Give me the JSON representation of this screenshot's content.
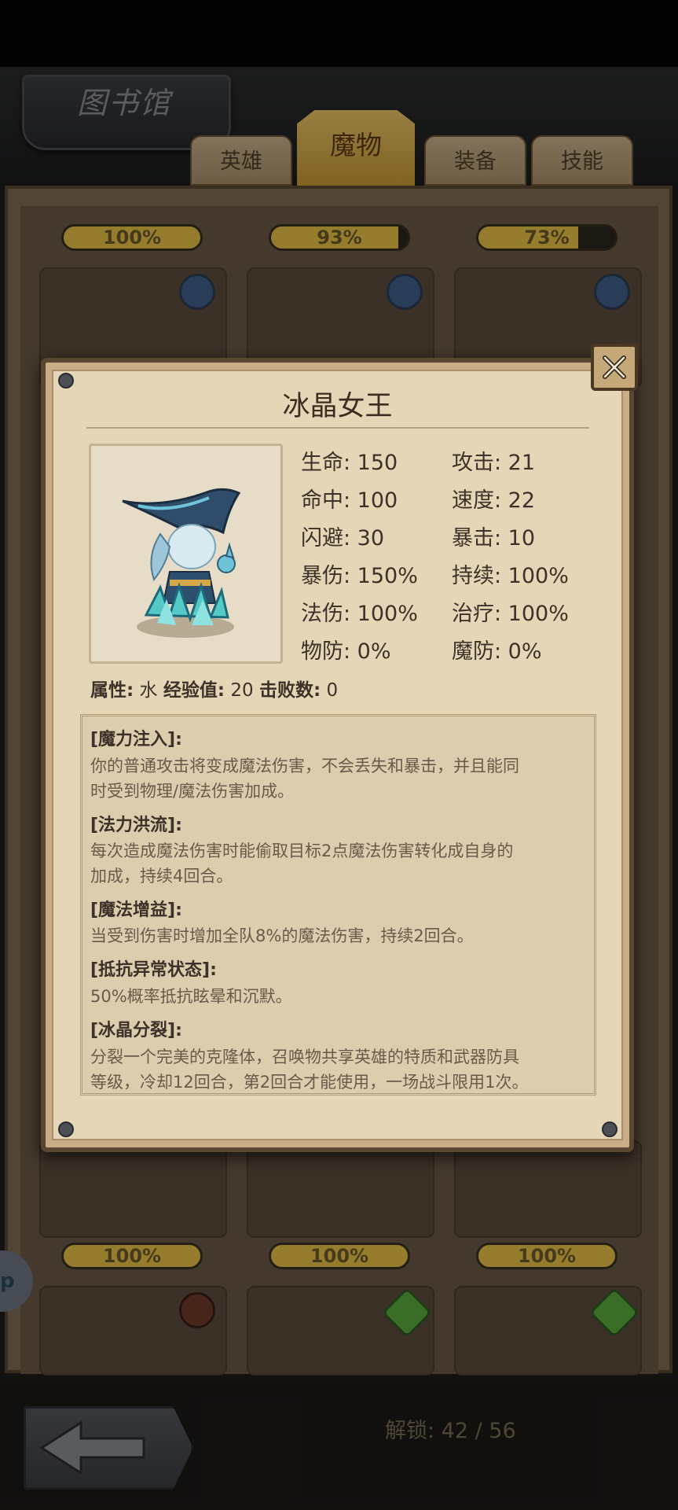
{
  "header": {
    "title": "图书馆",
    "tabs": [
      {
        "label": "英雄",
        "active": false
      },
      {
        "label": "魔物",
        "active": true
      },
      {
        "label": "装备",
        "active": false
      },
      {
        "label": "技能",
        "active": false
      }
    ]
  },
  "library": {
    "top_row_progress": [
      "100%",
      "93%",
      "73%"
    ],
    "top_row_fill": [
      1.0,
      0.93,
      0.73
    ],
    "bottom_row_progress": [
      "100%",
      "100%",
      "100%"
    ]
  },
  "monster": {
    "name": "冰晶女王",
    "stats": {
      "hp": "生命: 150",
      "attack": "攻击: 21",
      "hit": "命中: 100",
      "speed": "速度: 22",
      "dodge": "闪避: 30",
      "crit": "暴击: 10",
      "crit_damage": "暴伤: 150%",
      "duration": "持续: 100%",
      "magic_damage": "法伤: 100%",
      "healing": "治疗: 100%",
      "phys_def": "物防: 0%",
      "magic_def": "魔防: 0%"
    },
    "info": {
      "attribute_label": "属性:",
      "attribute_value": "水",
      "exp_label": "经验值:",
      "exp_value": "20",
      "defeats_label": "击败数:",
      "defeats_value": "0"
    },
    "skills": [
      {
        "name": "[魔力注入]:",
        "desc_lines": [
          "你的普通攻击将变成魔法伤害，不会丢失和暴击，并且能同",
          "时受到物理/魔法伤害加成。"
        ]
      },
      {
        "name": "[法力洪流]:",
        "desc_lines": [
          "每次造成魔法伤害时能偷取目标2点魔法伤害转化成自身的",
          "加成，持续4回合。"
        ]
      },
      {
        "name": "[魔法增益]:",
        "desc_lines": [
          "当受到伤害时增加全队8%的魔法伤害，持续2回合。"
        ]
      },
      {
        "name": "[抵抗异常状态]:",
        "desc_lines": [
          "50%概率抵抗眩晕和沉默。"
        ]
      },
      {
        "name": "[冰晶分裂]:",
        "desc_lines": [
          "分裂一个完美的克隆体，召唤物共享英雄的特质和武器防具",
          "等级，冷却12回合，第2回合才能使用，一场战斗限用1次。"
        ]
      }
    ]
  },
  "footer": {
    "unlock": "解锁: 42 / 56",
    "help": "p"
  },
  "colors": {
    "progress_fill": "#e7c045",
    "paper": "#e6d6b8",
    "frame": "#5b4630"
  }
}
